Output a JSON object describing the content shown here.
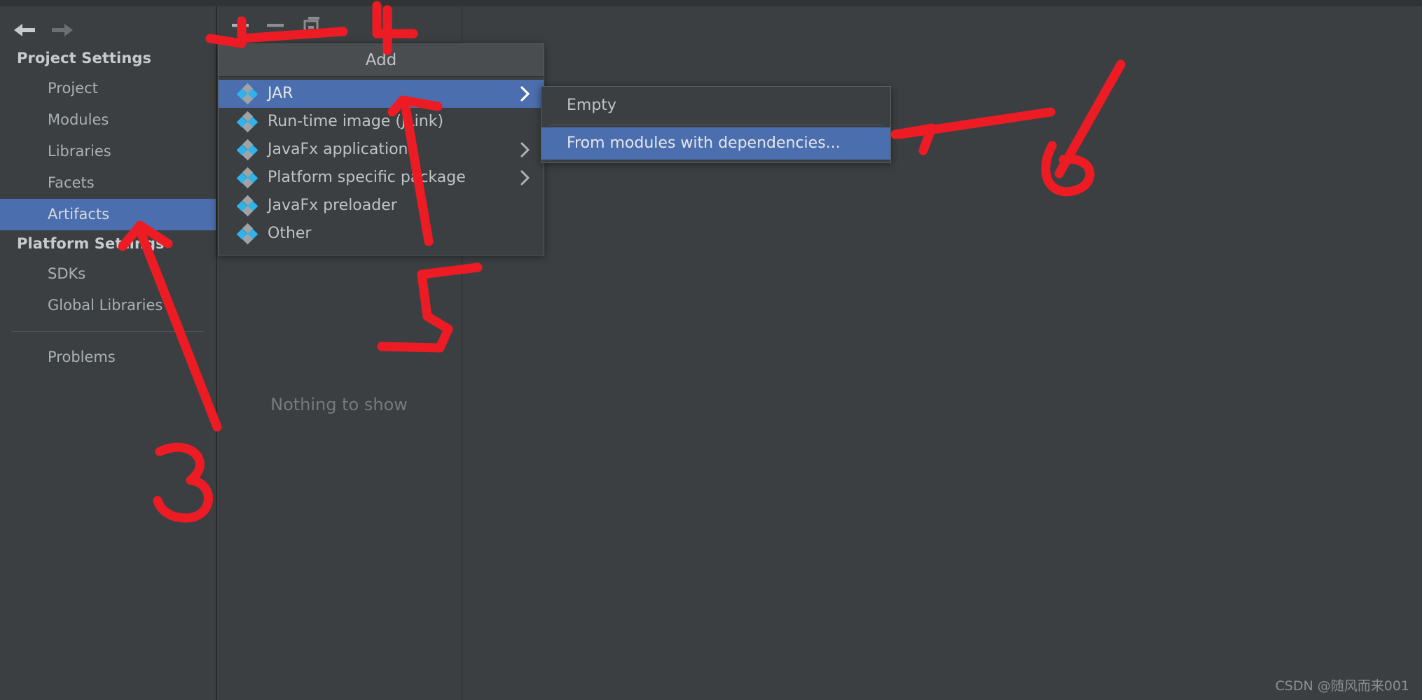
{
  "window": {
    "background_color": "#3C3F41",
    "accent_color": "#4B6EAF",
    "annotation_color": "#ED1C24"
  },
  "nav": {
    "back_label": "Back",
    "forward_label": "Forward",
    "back_icon": "arrow-left-icon",
    "forward_icon": "arrow-right-icon"
  },
  "sidebar": {
    "groups": [
      {
        "title": "Project Settings",
        "items": [
          {
            "label": "Project",
            "selected": false
          },
          {
            "label": "Modules",
            "selected": false
          },
          {
            "label": "Libraries",
            "selected": false
          },
          {
            "label": "Facets",
            "selected": false
          },
          {
            "label": "Artifacts",
            "selected": true
          }
        ]
      },
      {
        "title": "Platform Settings",
        "items": [
          {
            "label": "SDKs",
            "selected": false
          },
          {
            "label": "Global Libraries",
            "selected": false
          }
        ]
      }
    ],
    "extra_items": [
      {
        "label": "Problems",
        "selected": false
      }
    ]
  },
  "toolbar": {
    "buttons": [
      {
        "name": "add-button",
        "icon": "plus-icon",
        "label": "Add"
      },
      {
        "name": "remove-button",
        "icon": "minus-icon",
        "label": "Remove"
      },
      {
        "name": "copy-button",
        "icon": "copy-icon",
        "label": "Copy"
      }
    ]
  },
  "center_pane": {
    "empty_message": "Nothing to show"
  },
  "add_menu": {
    "title": "Add",
    "items": [
      {
        "label": "JAR",
        "icon": "artifact-diamond-icon",
        "has_submenu": true,
        "highlighted": true
      },
      {
        "label": "Run-time image (JLink)",
        "icon": "artifact-diamond-icon",
        "has_submenu": false,
        "highlighted": false
      },
      {
        "label": "JavaFx application",
        "icon": "artifact-diamond-icon",
        "has_submenu": true,
        "highlighted": false
      },
      {
        "label": "Platform specific package",
        "icon": "artifact-diamond-icon",
        "has_submenu": true,
        "highlighted": false
      },
      {
        "label": "JavaFx preloader",
        "icon": "artifact-diamond-icon",
        "has_submenu": false,
        "highlighted": false
      },
      {
        "label": "Other",
        "icon": "artifact-diamond-icon",
        "has_submenu": false,
        "highlighted": false
      }
    ]
  },
  "jar_submenu": {
    "items": [
      {
        "label": "Empty",
        "highlighted": false,
        "separator_after": true
      },
      {
        "label": "From modules with dependencies...",
        "highlighted": true,
        "separator_after": false
      }
    ]
  },
  "annotations": {
    "marks": [
      {
        "text": "3",
        "target": "Artifacts sidebar item"
      },
      {
        "text": "4",
        "target": "Add toolbar button"
      },
      {
        "text": "5",
        "target": "JAR menu item"
      },
      {
        "text": "6",
        "target": "From modules with dependencies submenu item"
      }
    ]
  },
  "watermark": {
    "text": "CSDN @随风而来001"
  }
}
